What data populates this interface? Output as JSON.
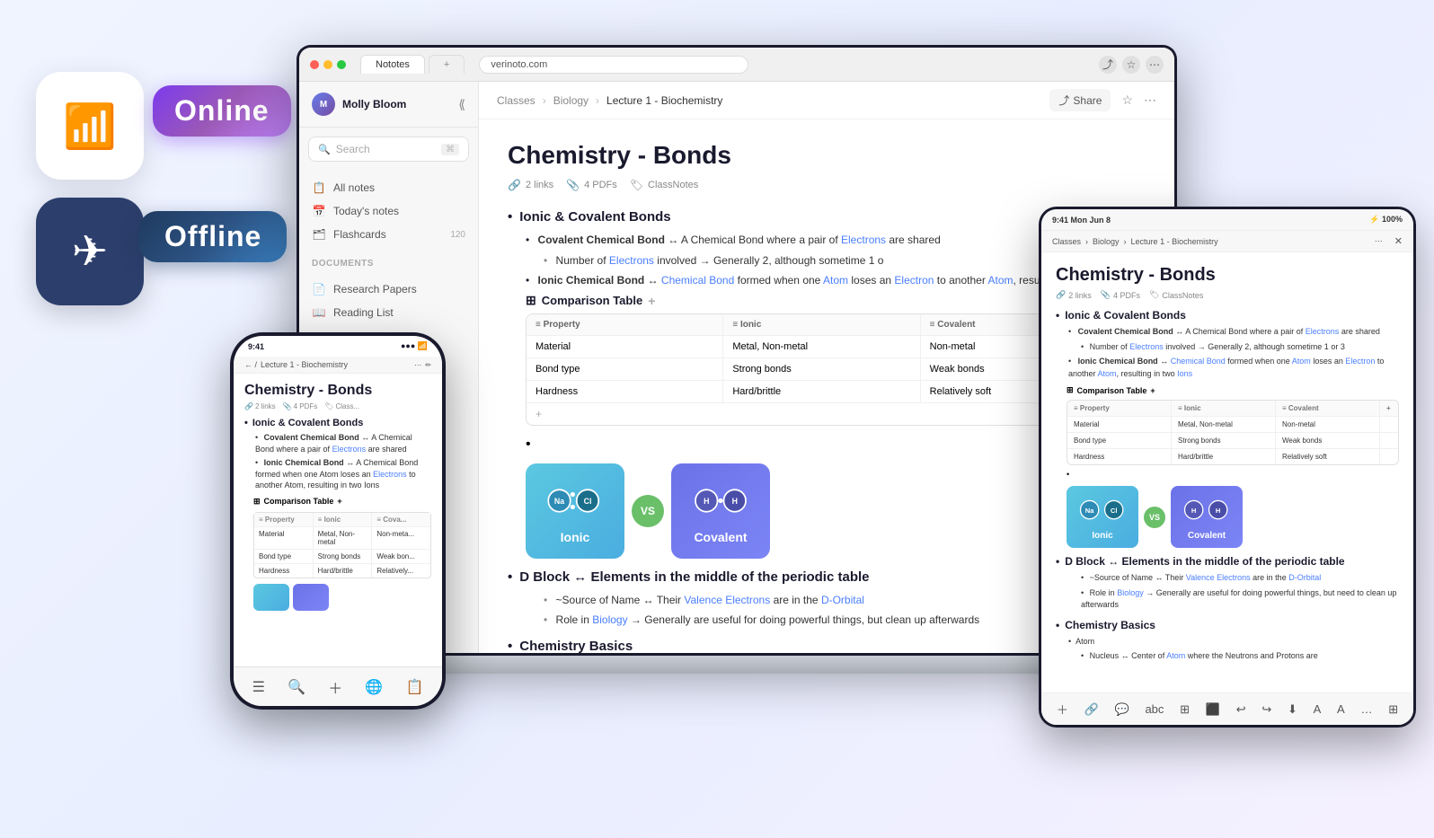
{
  "page": {
    "background": "gradient"
  },
  "wifi_widget": {
    "icon": "📶"
  },
  "airplane_widget": {
    "icon": "✈"
  },
  "badges": {
    "online": "Online",
    "offline": "Offline"
  },
  "laptop": {
    "browser": {
      "tab1": "Nototes",
      "tab2": "+ ",
      "url": "verinoto.com"
    },
    "breadcrumb": {
      "classes": "Classes",
      "biology": "Biology",
      "lecture": "Lecture 1 - Biochemistry"
    },
    "sidebar": {
      "user": "Molly Bloom",
      "search_placeholder": "Search",
      "search_shortcut": "⌘",
      "nav_items": [
        {
          "label": "All notes",
          "icon": "📋",
          "count": ""
        },
        {
          "label": "Today's notes",
          "icon": "📅",
          "count": ""
        },
        {
          "label": "Flashcards",
          "icon": "🗂",
          "count": "120"
        }
      ],
      "section_label": "DOCUMENTS",
      "doc_items": [
        {
          "label": "Research Papers",
          "icon": "📄"
        },
        {
          "label": "Reading List",
          "icon": "📖"
        }
      ]
    },
    "note": {
      "title": "Chemistry -  Bonds",
      "meta": {
        "links": "2 links",
        "pdfs": "4 PDFs",
        "classnotes": "ClassNotes"
      },
      "sections": {
        "ionic_covalent": "Ionic & Covalent Bonds",
        "covalent_bond": "Covalent Chemical Bond ↔ A Chemical Bond where a pair of",
        "covalent_link": "Electrons",
        "covalent_rest": "are shared",
        "electrons_count": "Number of Electrons involved → Generally 2, although sometime 1 o",
        "ionic_bond": "Ionic Chemical Bond ↔",
        "chemical_bond_link": "Chemical Bond",
        "ionic_rest": "formed when one Atom loses an",
        "ionic_rest2": "another Atom, resulting in two Ions",
        "comparison_label": "Comparison Table",
        "table_headers": [
          "Property",
          "Ionic",
          "Covalent"
        ],
        "table_rows": [
          [
            "Material",
            "Metal, Non-metal",
            "Non-metal"
          ],
          [
            "Bond type",
            "Strong bonds",
            "Weak bonds"
          ],
          [
            "Hardness",
            "Hard/brittle",
            "Relatively soft"
          ]
        ],
        "ionic_label": "Ionic",
        "covalent_label": "Covalent",
        "vs_label": "VS",
        "d_block": "D Block ↔ Elements in the middle of the periodic table",
        "d_block_sub": "~Source of Name ↔ Their",
        "valence_link": "Valence Electrons",
        "d_orbital_link": "D-Orbital",
        "d_block_role": "Role in",
        "biology_link": "Biology",
        "d_block_role_rest": "→ Generally are useful for doing powerful things, but",
        "d_block_role_rest2": "clean up afterwards",
        "chemistry_basics": "Chemistry Basics"
      }
    }
  },
  "phone": {
    "time": "9:41",
    "breadcrumb": "Lecture 1 - Biochemistry",
    "title": "Chemistry -  Bonds",
    "meta": {
      "links": "2 links",
      "pdfs": "4 PDFs",
      "class": "Class..."
    },
    "sections": {
      "ionic_covalent": "Ionic & Covalent Bonds",
      "covalent_bond_label": "Covalent Chemical Bond ↔ A Chemical Bond where a pair of",
      "electrons_link": "Electrons",
      "covalent_shared": "are shared",
      "ionic_bond_label": "Ionic Chemical Bond ↔ A Chemical Bond formed when one Atom loses an",
      "electrons_link2": "Electrons",
      "ionic_to": "to another Atom, resulting in two Ions",
      "comparison_label": "Comparison Table",
      "table_headers": [
        "Property",
        "Ionic",
        "Cova..."
      ],
      "table_rows": [
        [
          "Material",
          "Metal, Non-metal",
          "Non-meta..."
        ],
        [
          "Bond type",
          "Strong bonds",
          "Weak bon..."
        ],
        [
          "Hardness",
          "Hard/brittle",
          "Relatively..."
        ]
      ]
    },
    "bottom_nav": [
      "☰",
      "🔍",
      "+",
      "🌐",
      "📋"
    ]
  },
  "tablet": {
    "status": "9:41  Mon Jun 8",
    "signal": "⚡ 100%",
    "breadcrumb": {
      "classes": "Classes",
      "biology": "Biology",
      "lecture": "Lecture 1 - Biochemistry"
    },
    "title": "Chemistry - Bonds",
    "meta": {
      "links": "2 links",
      "pdfs": "4 PDFs",
      "classnotes": "ClassNotes"
    },
    "sections": {
      "ionic_covalent": "Ionic & Covalent Bonds",
      "covalent_bond": "Covalent Chemical Bond ↔ A Chemical Bond where a pair of",
      "electrons_link": "Electrons",
      "covalent_rest": "are shared",
      "electrons_count": "Number of Electrons involved → Generally 2, although sometime 1 or 3",
      "ionic_bond": "Ionic Chemical Bond ↔",
      "chemical_bond_link": "Chemical Bond",
      "ionic_rest": "formed when one Atom loses an Electron to another Atom, resulting in two Ions",
      "comparison_label": "Comparison Table",
      "table_headers": [
        "Property",
        "Ionic",
        "Covalent"
      ],
      "table_rows": [
        [
          "Material",
          "Metal, Non-metal",
          "Non-metal"
        ],
        [
          "Bond type",
          "Strong bonds",
          "Weak bonds"
        ],
        [
          "Hardness",
          "Hard/brittle",
          "Relatively soft"
        ]
      ],
      "ionic_label": "Ionic",
      "covalent_label": "Covalent",
      "vs_label": "VS",
      "d_block": "D Block ↔ Elements in the middle of the periodic table",
      "d_block_sub1": "~Source of Name ↔ Their",
      "valence_link": "Valence Electrons",
      "d_orbital": "are in the D-Orbital",
      "d_block_role": "Role in Biology → Generally are useful for doing powerful things, but need to clean up afterwards",
      "chemistry_basics": "Chemistry Basics",
      "atom": "Atom",
      "nucleus": "Nucleus ↔ Center of",
      "atom_link": "Atom",
      "nucleus_rest": "where the Neutrons and Protons are"
    },
    "toolbar_icons": [
      "➕",
      "🔗",
      "💬",
      "abc",
      "⌹",
      "⬛",
      "↩",
      "↪",
      "⬇",
      "A",
      "A",
      "…",
      "⊞"
    ]
  }
}
